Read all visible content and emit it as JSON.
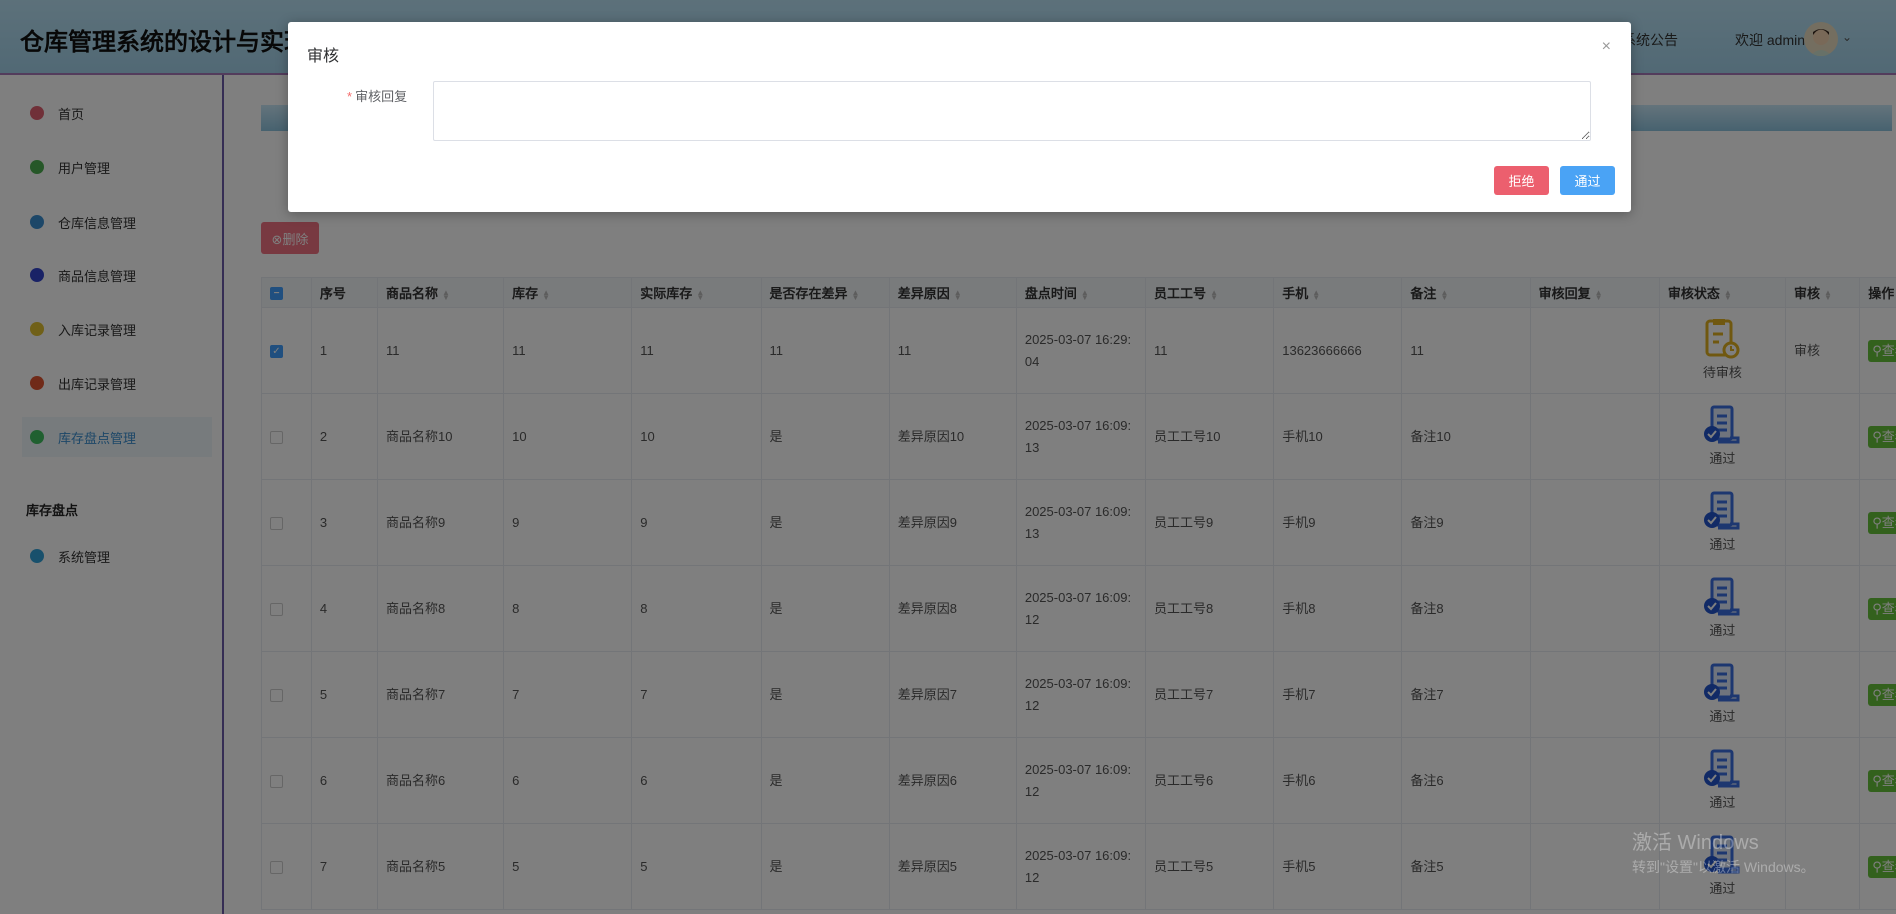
{
  "header": {
    "title": "仓库管理系统的设计与实现",
    "notice": "系统公告",
    "welcome": "欢迎 admin"
  },
  "sidebar": {
    "items": [
      {
        "label": "首页",
        "icon": "home-icon",
        "color": "#e06070"
      },
      {
        "label": "用户管理",
        "icon": "user-icon",
        "color": "#4caf50"
      },
      {
        "label": "仓库信息管理",
        "icon": "grid-icon",
        "color": "#3a8fd0"
      },
      {
        "label": "商品信息管理",
        "icon": "clock-icon",
        "color": "#3344cc"
      },
      {
        "label": "入库记录管理",
        "icon": "coin-icon",
        "color": "#e0c030"
      },
      {
        "label": "出库记录管理",
        "icon": "box-icon",
        "color": "#e05530"
      },
      {
        "label": "库存盘点管理",
        "icon": "clover-icon",
        "color": "#40c060"
      }
    ],
    "group_label": "库存盘点",
    "system": {
      "label": "系统管理",
      "icon": "gauge-icon",
      "color": "#30a0d8"
    }
  },
  "toolbar": {
    "delete_label": "⊗删除"
  },
  "table": {
    "columns": [
      "序号",
      "商品名称",
      "库存",
      "实际库存",
      "是否存在差异",
      "差异原因",
      "盘点时间",
      "员工工号",
      "手机",
      "备注",
      "审核回复",
      "审核状态",
      "审核",
      "操作"
    ],
    "view_label": "查看",
    "rows": [
      {
        "checked": true,
        "no": "1",
        "name": "11",
        "stock": "11",
        "actual": "11",
        "diff": "11",
        "reason": "11",
        "time": "2025-03-07 16:29:04",
        "emp": "11",
        "phone": "13623666666",
        "note": "11",
        "reply": "",
        "status": "待审核",
        "audit": "审核"
      },
      {
        "checked": false,
        "no": "2",
        "name": "商品名称10",
        "stock": "10",
        "actual": "10",
        "diff": "是",
        "reason": "差异原因10",
        "time": "2025-03-07 16:09:13",
        "emp": "员工工号10",
        "phone": "手机10",
        "note": "备注10",
        "reply": "",
        "status": "通过",
        "audit": ""
      },
      {
        "checked": false,
        "no": "3",
        "name": "商品名称9",
        "stock": "9",
        "actual": "9",
        "diff": "是",
        "reason": "差异原因9",
        "time": "2025-03-07 16:09:13",
        "emp": "员工工号9",
        "phone": "手机9",
        "note": "备注9",
        "reply": "",
        "status": "通过",
        "audit": ""
      },
      {
        "checked": false,
        "no": "4",
        "name": "商品名称8",
        "stock": "8",
        "actual": "8",
        "diff": "是",
        "reason": "差异原因8",
        "time": "2025-03-07 16:09:12",
        "emp": "员工工号8",
        "phone": "手机8",
        "note": "备注8",
        "reply": "",
        "status": "通过",
        "audit": ""
      },
      {
        "checked": false,
        "no": "5",
        "name": "商品名称7",
        "stock": "7",
        "actual": "7",
        "diff": "是",
        "reason": "差异原因7",
        "time": "2025-03-07 16:09:12",
        "emp": "员工工号7",
        "phone": "手机7",
        "note": "备注7",
        "reply": "",
        "status": "通过",
        "audit": ""
      },
      {
        "checked": false,
        "no": "6",
        "name": "商品名称6",
        "stock": "6",
        "actual": "6",
        "diff": "是",
        "reason": "差异原因6",
        "time": "2025-03-07 16:09:12",
        "emp": "员工工号6",
        "phone": "手机6",
        "note": "备注6",
        "reply": "",
        "status": "通过",
        "audit": ""
      },
      {
        "checked": false,
        "no": "7",
        "name": "商品名称5",
        "stock": "5",
        "actual": "5",
        "diff": "是",
        "reason": "差异原因5",
        "time": "2025-03-07 16:09:12",
        "emp": "员工工号5",
        "phone": "手机5",
        "note": "备注5",
        "reply": "",
        "status": "通过",
        "audit": ""
      }
    ]
  },
  "dialog": {
    "title": "审核",
    "close": "×",
    "field_label": "审核回复",
    "required_mark": "*",
    "reply_value": "",
    "reject_label": "拒绝",
    "pass_label": "通过"
  },
  "watermark": {
    "line1": "激活 Windows",
    "line2": "转到\"设置\"以激活 Windows。"
  }
}
